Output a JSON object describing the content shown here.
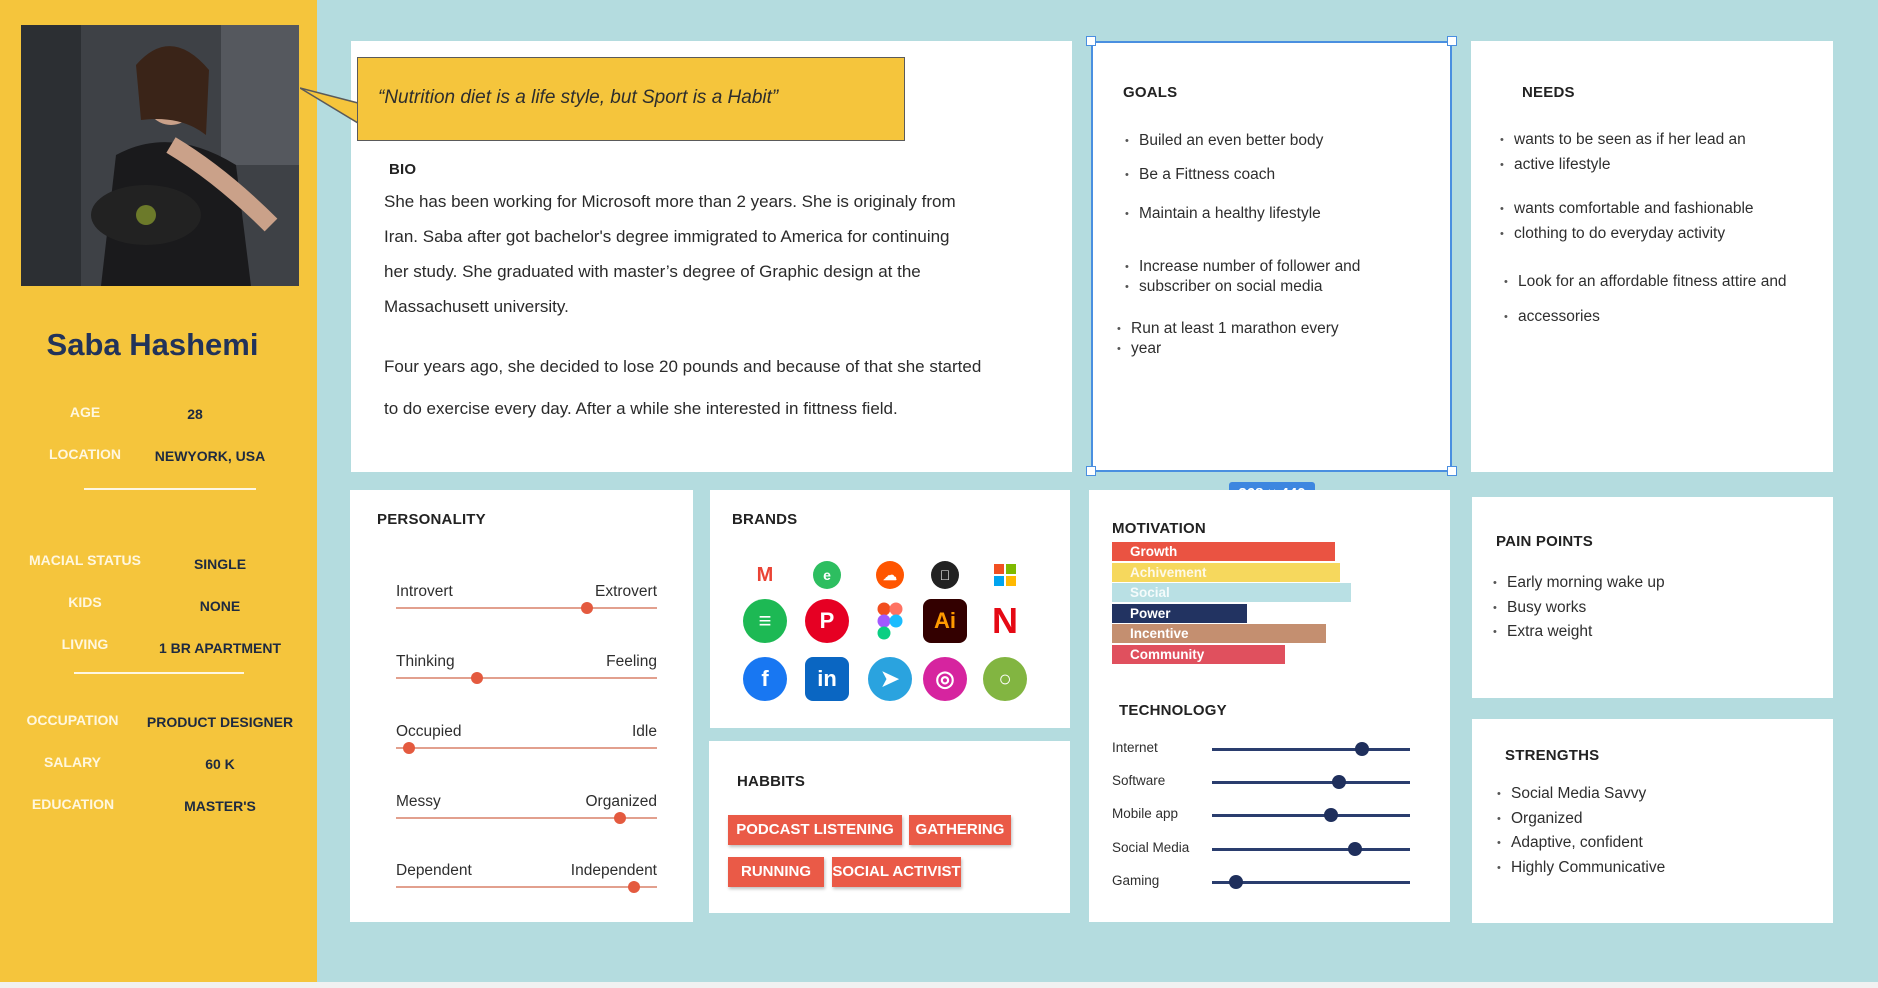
{
  "persona": {
    "name": "Saba Hashemi",
    "info": [
      {
        "label": "AGE",
        "value": "28"
      },
      {
        "label": "LOCATION",
        "value": "NEWYORK, USA"
      },
      {
        "label": "MACIAL STATUS",
        "value": "SINGLE"
      },
      {
        "label": "KIDS",
        "value": "NONE"
      },
      {
        "label": "LIVING",
        "value": "1 BR APARTMENT"
      },
      {
        "label": "OCCUPATION",
        "value": "PRODUCT DESIGNER"
      },
      {
        "label": "SALARY",
        "value": "60 K"
      },
      {
        "label": "EDUCATION",
        "value": "MASTER'S"
      }
    ]
  },
  "quote": "“Nutrition diet is a life style, but Sport is a Habit”",
  "bio": {
    "title": "BIO",
    "lines": [
      "She has been working for Microsoft more than 2 years. She is originaly from",
      "Iran. Saba after got bachelor's degree immigrated to America for continuing",
      "her study. She graduated with master’s degree of Graphic design at the",
      "Massachusett university.",
      "Four years ago, she decided to lose 20 pounds and because of that she started",
      "to do exercise every day. After a while she interested in fittness field."
    ]
  },
  "goals": {
    "title": "GOALS",
    "items": [
      "Builed an even better body",
      "Be a  Fittness coach",
      "Maintain a healthy lifestyle",
      "Increase number of follower and",
      "subscriber on social media",
      "Run at least 1 marathon every",
      "year"
    ]
  },
  "needs": {
    "title": "NEEDS",
    "items": [
      "wants to be seen as if her lead an",
      "active lifestyle",
      "wants comfortable and fashionable",
      "clothing to do everyday activity",
      "Look for an affordable fitness attire and",
      "accessories"
    ]
  },
  "selection_size": "368 × 440",
  "personality": {
    "title": "PERSONALITY",
    "sliders": [
      {
        "left": "Introvert",
        "right": "Extrovert",
        "value": 0.73
      },
      {
        "left": "Thinking",
        "right": "Feeling",
        "value": 0.31
      },
      {
        "left": "Occupied",
        "right": "Idle",
        "value": 0.05
      },
      {
        "left": "Messy",
        "right": "Organized",
        "value": 0.86
      },
      {
        "left": "Dependent",
        "right": "Independent",
        "value": 0.91
      }
    ]
  },
  "brands": {
    "title": "BRANDS",
    "icons": [
      {
        "name": "gmail",
        "glyph": "M",
        "color": "#ea4335"
      },
      {
        "name": "evernote",
        "glyph": "e",
        "color": "#2dbe60"
      },
      {
        "name": "soundcloud",
        "glyph": "☁",
        "color": "#ff5500"
      },
      {
        "name": "apple",
        "glyph": "",
        "color": "#222222"
      },
      {
        "name": "microsoft",
        "glyph": "",
        "color": "#f25022"
      },
      {
        "name": "spotify",
        "glyph": "≡",
        "color": "#1db954"
      },
      {
        "name": "pinterest",
        "glyph": "P",
        "color": "#e60023"
      },
      {
        "name": "figma",
        "glyph": "",
        "color": "#a259ff"
      },
      {
        "name": "illustrator",
        "glyph": "Ai",
        "color": "#330000"
      },
      {
        "name": "netflix",
        "glyph": "N",
        "color": "#e50914"
      },
      {
        "name": "facebook",
        "glyph": "f",
        "color": "#1877f2"
      },
      {
        "name": "linkedin",
        "glyph": "in",
        "color": "#0a66c2"
      },
      {
        "name": "telegram",
        "glyph": "➤",
        "color": "#2aa3df"
      },
      {
        "name": "instagram",
        "glyph": "◎",
        "color": "#d6249f"
      },
      {
        "name": "envato",
        "glyph": "○",
        "color": "#82b541"
      }
    ]
  },
  "habits": {
    "title": "HABBITS",
    "tags": [
      "PODCAST LISTENING",
      "GATHERING",
      "RUNNING",
      "SOCIAL ACTIVIST"
    ]
  },
  "motivation": {
    "title": "MOTIVATION",
    "bars": [
      {
        "label": "Growth",
        "value": 0.98,
        "color": "#ea5342"
      },
      {
        "label": "Achivement",
        "value": 1.0,
        "color": "#f6d85d"
      },
      {
        "label": "Social",
        "value": 1.05,
        "color": "#b9e0e4"
      },
      {
        "label": "Power",
        "value": 0.59,
        "color": "#223361"
      },
      {
        "label": "Incentive",
        "value": 0.94,
        "color": "#c48f70"
      },
      {
        "label": "Community",
        "value": 0.76,
        "color": "#e0505e"
      }
    ]
  },
  "technology": {
    "title": "TECHNOLOGY",
    "items": [
      {
        "label": "Internet",
        "value": 0.76
      },
      {
        "label": "Software",
        "value": 0.64
      },
      {
        "label": "Mobile app",
        "value": 0.6
      },
      {
        "label": "Social Media",
        "value": 0.72
      },
      {
        "label": "Gaming",
        "value": 0.12
      }
    ]
  },
  "pain_points": {
    "title": "PAIN POINTS",
    "items": [
      "Early morning wake up",
      "Busy works",
      "Extra weight"
    ]
  },
  "strengths": {
    "title": "STRENGTHS",
    "items": [
      "Social Media Savvy",
      "Organized",
      "Adaptive, confident",
      "Highly Communicative"
    ]
  }
}
